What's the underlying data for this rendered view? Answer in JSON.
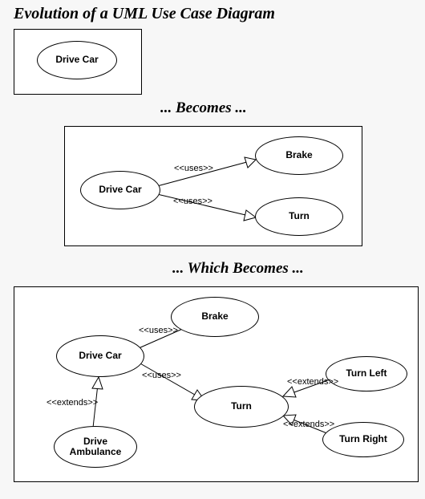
{
  "title": "Evolution of a UML Use Case Diagram",
  "captions": {
    "becomes": "... Becomes ...",
    "which_becomes": "... Which Becomes ..."
  },
  "stereotypes": {
    "uses": "<<uses>>",
    "extends": "<<extends>>"
  },
  "use_cases": {
    "drive_car": "Drive Car",
    "brake": "Brake",
    "turn": "Turn",
    "turn_left": "Turn Left",
    "turn_right": "Turn Right",
    "drive_ambulance": "Drive\nAmbulance"
  }
}
